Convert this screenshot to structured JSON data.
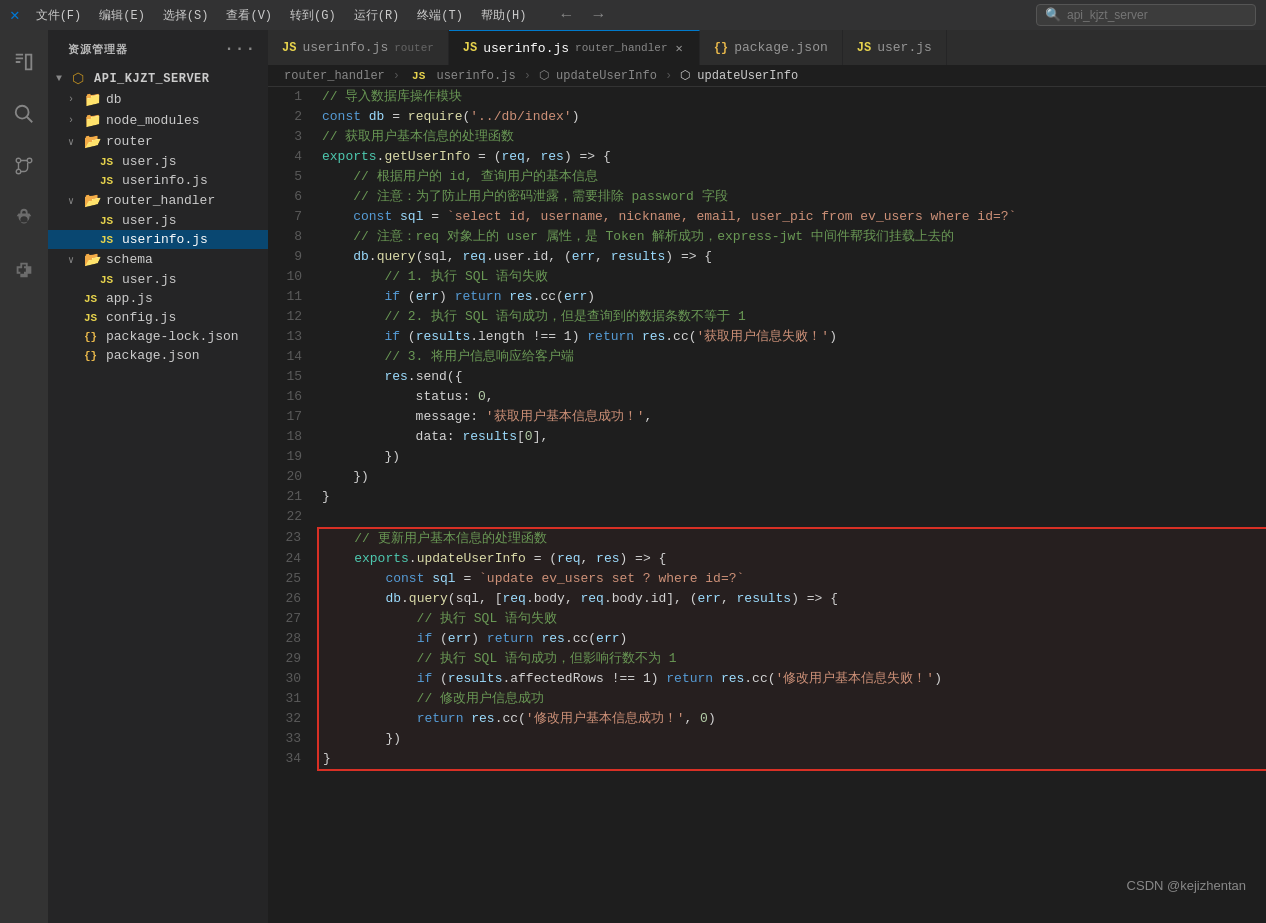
{
  "titleBar": {
    "icon": "✕",
    "menus": [
      "文件(F)",
      "编辑(E)",
      "选择(S)",
      "查看(V)",
      "转到(G)",
      "运行(R)",
      "终端(T)",
      "帮助(H)"
    ],
    "searchPlaceholder": "api_kjzt_server",
    "navBack": "←",
    "navForward": "→"
  },
  "sidebar": {
    "title": "资源管理器",
    "dotsLabel": "···",
    "root": "API_KJZT_SERVER",
    "items": [
      {
        "label": "db",
        "type": "folder",
        "indent": 1,
        "expanded": false
      },
      {
        "label": "node_modules",
        "type": "folder",
        "indent": 1,
        "expanded": false
      },
      {
        "label": "router",
        "type": "folder",
        "indent": 1,
        "expanded": true
      },
      {
        "label": "user.js",
        "type": "js",
        "indent": 2
      },
      {
        "label": "userinfo.js",
        "type": "js",
        "indent": 2
      },
      {
        "label": "router_handler",
        "type": "folder",
        "indent": 1,
        "expanded": true
      },
      {
        "label": "user.js",
        "type": "js",
        "indent": 2
      },
      {
        "label": "userinfo.js",
        "type": "js",
        "indent": 2,
        "selected": true
      },
      {
        "label": "schema",
        "type": "folder",
        "indent": 1,
        "expanded": true
      },
      {
        "label": "user.js",
        "type": "js",
        "indent": 2
      },
      {
        "label": "app.js",
        "type": "js",
        "indent": 1
      },
      {
        "label": "config.js",
        "type": "js",
        "indent": 1
      },
      {
        "label": "package-lock.json",
        "type": "json",
        "indent": 1
      },
      {
        "label": "package.json",
        "type": "json",
        "indent": 1
      }
    ]
  },
  "tabs": [
    {
      "id": "tab1",
      "icon": "JS",
      "iconType": "js",
      "label": "userinfo.js",
      "sublabel": "router",
      "active": false,
      "closable": true
    },
    {
      "id": "tab2",
      "icon": "JS",
      "iconType": "js",
      "label": "userinfo.js",
      "sublabel": "router_handler",
      "active": true,
      "closable": true
    },
    {
      "id": "tab3",
      "icon": "{}",
      "iconType": "json",
      "label": "package.json",
      "active": false,
      "closable": false
    },
    {
      "id": "tab4",
      "icon": "JS",
      "iconType": "js",
      "label": "user.js",
      "active": false,
      "closable": false
    }
  ],
  "breadcrumb": {
    "parts": [
      "router_handler",
      "JS userinfo.js",
      "⬡ updateUserInfo",
      "⬡ updateUserInfo"
    ]
  },
  "lines": [
    {
      "num": 1,
      "tokens": [
        {
          "t": "// 导入数据库操作模块",
          "c": "c-comment"
        }
      ]
    },
    {
      "num": 2,
      "tokens": [
        {
          "t": "const ",
          "c": "c-keyword"
        },
        {
          "t": "db",
          "c": "c-variable"
        },
        {
          "t": " = ",
          "c": "c-plain"
        },
        {
          "t": "require",
          "c": "c-function"
        },
        {
          "t": "(",
          "c": "c-plain"
        },
        {
          "t": "'../db/index'",
          "c": "c-string"
        },
        {
          "t": ")",
          "c": "c-plain"
        }
      ]
    },
    {
      "num": 3,
      "tokens": [
        {
          "t": "// 获取用户基本信息的处理函数",
          "c": "c-comment"
        }
      ]
    },
    {
      "num": 4,
      "tokens": [
        {
          "t": "exports",
          "c": "c-exports"
        },
        {
          "t": ".",
          "c": "c-plain"
        },
        {
          "t": "getUserInfo",
          "c": "c-function"
        },
        {
          "t": " = (",
          "c": "c-plain"
        },
        {
          "t": "req",
          "c": "c-param"
        },
        {
          "t": ", ",
          "c": "c-plain"
        },
        {
          "t": "res",
          "c": "c-param"
        },
        {
          "t": ") => {",
          "c": "c-plain"
        }
      ]
    },
    {
      "num": 5,
      "tokens": [
        {
          "t": "    // 根据用户的 id, 查询用户的基本信息",
          "c": "c-comment"
        }
      ]
    },
    {
      "num": 6,
      "tokens": [
        {
          "t": "    // 注意：为了防止用户的密码泄露，需要排除 password 字段",
          "c": "c-comment"
        }
      ]
    },
    {
      "num": 7,
      "tokens": [
        {
          "t": "    ",
          "c": "c-plain"
        },
        {
          "t": "const ",
          "c": "c-keyword"
        },
        {
          "t": "sql",
          "c": "c-variable"
        },
        {
          "t": " = ",
          "c": "c-plain"
        },
        {
          "t": "`select id, username, nickname, email, user_pic from ev_users where id=?`",
          "c": "c-template"
        }
      ]
    },
    {
      "num": 8,
      "tokens": [
        {
          "t": "    // 注意：req 对象上的 user 属性，是 Token 解析成功，express-jwt 中间件帮我们挂载上去的",
          "c": "c-comment"
        }
      ]
    },
    {
      "num": 9,
      "tokens": [
        {
          "t": "    ",
          "c": "c-plain"
        },
        {
          "t": "db",
          "c": "c-variable"
        },
        {
          "t": ".",
          "c": "c-plain"
        },
        {
          "t": "query",
          "c": "c-function"
        },
        {
          "t": "(sql, ",
          "c": "c-plain"
        },
        {
          "t": "req",
          "c": "c-variable"
        },
        {
          "t": ".user.id, (",
          "c": "c-plain"
        },
        {
          "t": "err",
          "c": "c-param"
        },
        {
          "t": ", ",
          "c": "c-plain"
        },
        {
          "t": "results",
          "c": "c-param"
        },
        {
          "t": ") => {",
          "c": "c-plain"
        }
      ]
    },
    {
      "num": 10,
      "tokens": [
        {
          "t": "        // 1. 执行 SQL 语句失败",
          "c": "c-comment"
        }
      ]
    },
    {
      "num": 11,
      "tokens": [
        {
          "t": "        ",
          "c": "c-plain"
        },
        {
          "t": "if",
          "c": "c-keyword"
        },
        {
          "t": " (",
          "c": "c-plain"
        },
        {
          "t": "err",
          "c": "c-variable"
        },
        {
          "t": ") ",
          "c": "c-plain"
        },
        {
          "t": "return ",
          "c": "c-keyword"
        },
        {
          "t": "res",
          "c": "c-variable"
        },
        {
          "t": ".cc(",
          "c": "c-plain"
        },
        {
          "t": "err",
          "c": "c-variable"
        },
        {
          "t": ")",
          "c": "c-plain"
        }
      ]
    },
    {
      "num": 12,
      "tokens": [
        {
          "t": "        // 2. 执行 SQL 语句成功，但是查询到的数据条数不等于 1",
          "c": "c-comment"
        }
      ]
    },
    {
      "num": 13,
      "tokens": [
        {
          "t": "        ",
          "c": "c-plain"
        },
        {
          "t": "if",
          "c": "c-keyword"
        },
        {
          "t": " (",
          "c": "c-plain"
        },
        {
          "t": "results",
          "c": "c-variable"
        },
        {
          "t": ".length !== 1) ",
          "c": "c-plain"
        },
        {
          "t": "return ",
          "c": "c-keyword"
        },
        {
          "t": "res",
          "c": "c-variable"
        },
        {
          "t": ".cc(",
          "c": "c-plain"
        },
        {
          "t": "'获取用户信息失败！'",
          "c": "c-string"
        },
        {
          "t": ")",
          "c": "c-plain"
        }
      ]
    },
    {
      "num": 14,
      "tokens": [
        {
          "t": "        // 3. 将用户信息响应给客户端",
          "c": "c-comment"
        }
      ]
    },
    {
      "num": 15,
      "tokens": [
        {
          "t": "        ",
          "c": "c-plain"
        },
        {
          "t": "res",
          "c": "c-variable"
        },
        {
          "t": ".send({",
          "c": "c-plain"
        }
      ]
    },
    {
      "num": 16,
      "tokens": [
        {
          "t": "            status: ",
          "c": "c-plain"
        },
        {
          "t": "0",
          "c": "c-number"
        },
        {
          "t": ",",
          "c": "c-plain"
        }
      ]
    },
    {
      "num": 17,
      "tokens": [
        {
          "t": "            message: ",
          "c": "c-plain"
        },
        {
          "t": "'获取用户基本信息成功！'",
          "c": "c-string"
        },
        {
          "t": ",",
          "c": "c-plain"
        }
      ]
    },
    {
      "num": 18,
      "tokens": [
        {
          "t": "            data: ",
          "c": "c-plain"
        },
        {
          "t": "results",
          "c": "c-variable"
        },
        {
          "t": "[",
          "c": "c-plain"
        },
        {
          "t": "0",
          "c": "c-number"
        },
        {
          "t": "],",
          "c": "c-plain"
        }
      ]
    },
    {
      "num": 19,
      "tokens": [
        {
          "t": "        })",
          "c": "c-plain"
        }
      ]
    },
    {
      "num": 20,
      "tokens": [
        {
          "t": "    })",
          "c": "c-plain"
        }
      ]
    },
    {
      "num": 21,
      "tokens": [
        {
          "t": "}",
          "c": "c-plain"
        }
      ]
    },
    {
      "num": 22,
      "tokens": []
    },
    {
      "num": 23,
      "tokens": [
        {
          "t": "    // 更新用户基本信息的处理函数",
          "c": "c-comment"
        }
      ],
      "highlighted": true,
      "hStart": true
    },
    {
      "num": 24,
      "tokens": [
        {
          "t": "    ",
          "c": "c-plain"
        },
        {
          "t": "exports",
          "c": "c-exports"
        },
        {
          "t": ".",
          "c": "c-plain"
        },
        {
          "t": "updateUserInfo",
          "c": "c-function"
        },
        {
          "t": " = (",
          "c": "c-plain"
        },
        {
          "t": "req",
          "c": "c-param"
        },
        {
          "t": ", ",
          "c": "c-plain"
        },
        {
          "t": "res",
          "c": "c-param"
        },
        {
          "t": ") => {",
          "c": "c-plain"
        }
      ],
      "highlighted": true
    },
    {
      "num": 25,
      "tokens": [
        {
          "t": "        ",
          "c": "c-plain"
        },
        {
          "t": "const ",
          "c": "c-keyword"
        },
        {
          "t": "sql",
          "c": "c-variable"
        },
        {
          "t": " = ",
          "c": "c-plain"
        },
        {
          "t": "`update ev_users set ? where id=?`",
          "c": "c-template"
        }
      ],
      "highlighted": true
    },
    {
      "num": 26,
      "tokens": [
        {
          "t": "        ",
          "c": "c-plain"
        },
        {
          "t": "db",
          "c": "c-variable"
        },
        {
          "t": ".",
          "c": "c-plain"
        },
        {
          "t": "query",
          "c": "c-function"
        },
        {
          "t": "(sql, [",
          "c": "c-plain"
        },
        {
          "t": "req",
          "c": "c-variable"
        },
        {
          "t": ".body, ",
          "c": "c-plain"
        },
        {
          "t": "req",
          "c": "c-variable"
        },
        {
          "t": ".body.id], (",
          "c": "c-plain"
        },
        {
          "t": "err",
          "c": "c-param"
        },
        {
          "t": ", ",
          "c": "c-plain"
        },
        {
          "t": "results",
          "c": "c-param"
        },
        {
          "t": ") => {",
          "c": "c-plain"
        }
      ],
      "highlighted": true
    },
    {
      "num": 27,
      "tokens": [
        {
          "t": "            // 执行 SQL 语句失败",
          "c": "c-comment"
        }
      ],
      "highlighted": true
    },
    {
      "num": 28,
      "tokens": [
        {
          "t": "            ",
          "c": "c-plain"
        },
        {
          "t": "if",
          "c": "c-keyword"
        },
        {
          "t": " (",
          "c": "c-plain"
        },
        {
          "t": "err",
          "c": "c-variable"
        },
        {
          "t": ") ",
          "c": "c-plain"
        },
        {
          "t": "return ",
          "c": "c-keyword"
        },
        {
          "t": "res",
          "c": "c-variable"
        },
        {
          "t": ".cc(",
          "c": "c-plain"
        },
        {
          "t": "err",
          "c": "c-variable"
        },
        {
          "t": ")",
          "c": "c-plain"
        }
      ],
      "highlighted": true
    },
    {
      "num": 29,
      "tokens": [
        {
          "t": "            // 执行 SQL 语句成功，但影响行数不为 1",
          "c": "c-comment"
        }
      ],
      "highlighted": true
    },
    {
      "num": 30,
      "tokens": [
        {
          "t": "            ",
          "c": "c-plain"
        },
        {
          "t": "if",
          "c": "c-keyword"
        },
        {
          "t": " (",
          "c": "c-plain"
        },
        {
          "t": "results",
          "c": "c-variable"
        },
        {
          "t": ".affectedRows !== 1) ",
          "c": "c-plain"
        },
        {
          "t": "return ",
          "c": "c-keyword"
        },
        {
          "t": "res",
          "c": "c-variable"
        },
        {
          "t": ".cc(",
          "c": "c-plain"
        },
        {
          "t": "'修改用户基本信息失败！'",
          "c": "c-string"
        },
        {
          "t": ")",
          "c": "c-plain"
        }
      ],
      "highlighted": true
    },
    {
      "num": 31,
      "tokens": [
        {
          "t": "            // 修改用户信息成功",
          "c": "c-comment"
        }
      ],
      "highlighted": true
    },
    {
      "num": 32,
      "tokens": [
        {
          "t": "            ",
          "c": "c-plain"
        },
        {
          "t": "return ",
          "c": "c-keyword"
        },
        {
          "t": "res",
          "c": "c-variable"
        },
        {
          "t": ".cc(",
          "c": "c-plain"
        },
        {
          "t": "'修改用户基本信息成功！'",
          "c": "c-string"
        },
        {
          "t": ", ",
          "c": "c-plain"
        },
        {
          "t": "0",
          "c": "c-number"
        },
        {
          "t": ")",
          "c": "c-plain"
        }
      ],
      "highlighted": true
    },
    {
      "num": 33,
      "tokens": [
        {
          "t": "        })",
          "c": "c-plain"
        }
      ],
      "highlighted": true
    },
    {
      "num": 34,
      "tokens": [
        {
          "t": "}",
          "c": "c-plain"
        }
      ],
      "highlighted": true,
      "hEnd": true
    }
  ],
  "csdn": "CSDN @kejizhentan"
}
